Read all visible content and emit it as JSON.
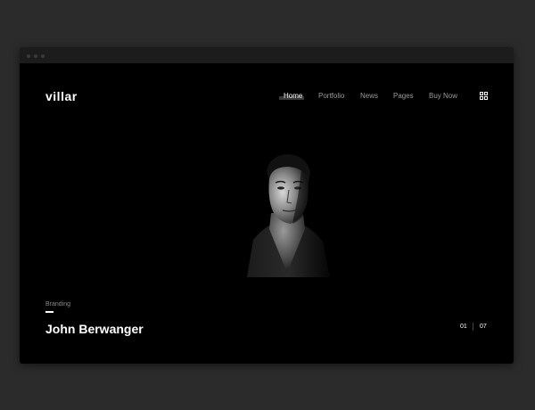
{
  "site": {
    "logo": "villar"
  },
  "nav": {
    "items": [
      {
        "label": "Home",
        "active": true
      },
      {
        "label": "Portfolio",
        "active": false
      },
      {
        "label": "News",
        "active": false
      },
      {
        "label": "Pages",
        "active": false
      },
      {
        "label": "Buy Now",
        "active": false
      }
    ],
    "menu_icon": "grid-icon"
  },
  "hero": {
    "category": "Branding",
    "title": "John Berwanger",
    "image": "portrait-photo"
  },
  "pager": {
    "current": "01",
    "total": "07"
  },
  "colors": {
    "page_bg": "#2b2b2b",
    "site_bg": "#000000",
    "text_primary": "#ffffff",
    "text_muted": "#9a9a9a"
  }
}
